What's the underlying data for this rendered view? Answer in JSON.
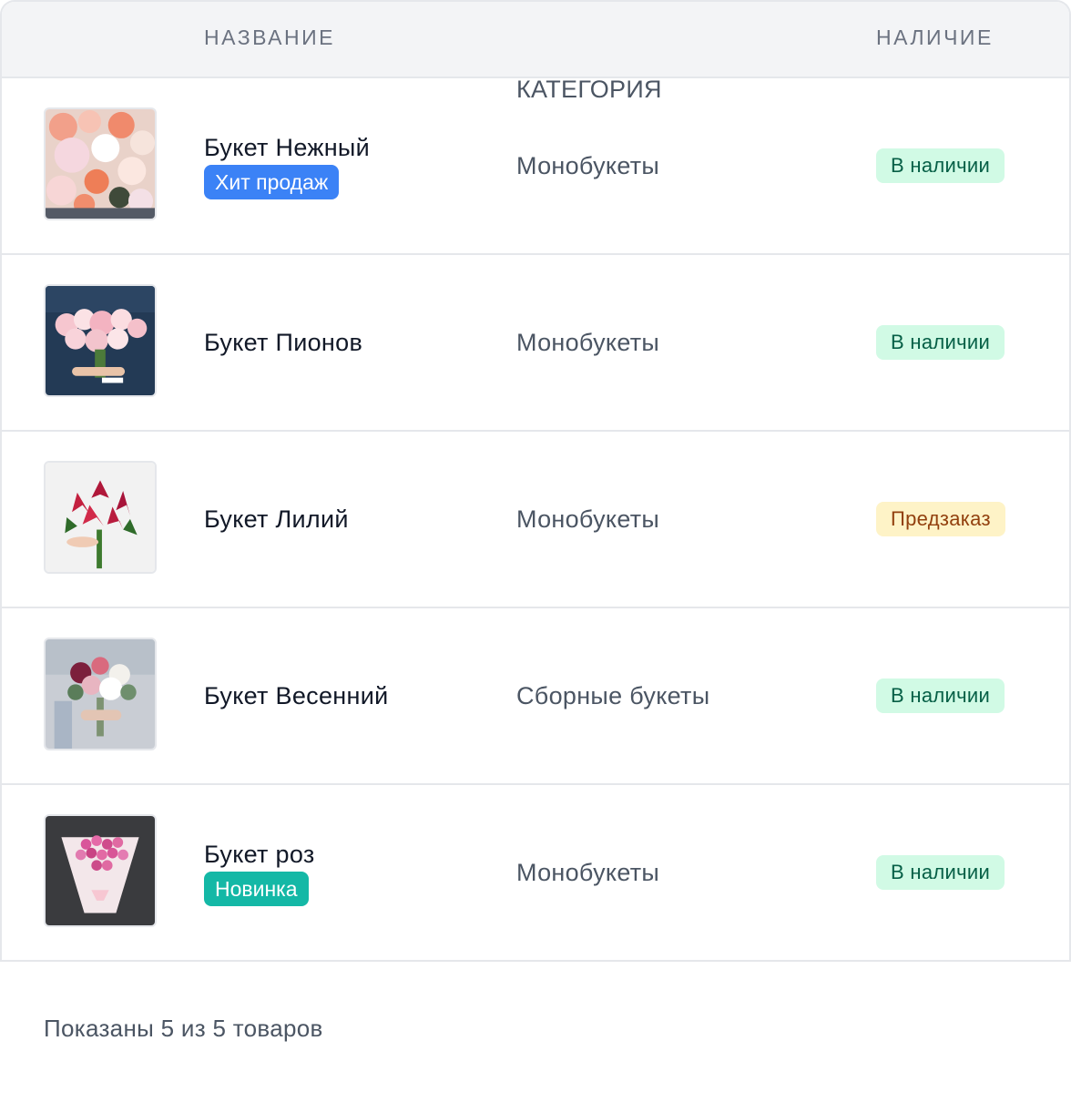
{
  "table": {
    "headers": {
      "name": "НАЗВАНИЕ",
      "category": "КАТЕГОРИЯ",
      "availability": "НАЛИЧИЕ"
    },
    "rows": [
      {
        "name": "Букет Нежный",
        "tag": "Хит продаж",
        "category": "Монобукеты",
        "availability": "В наличии",
        "thumb_icon": "peony-rose-bouquet-photo"
      },
      {
        "name": "Букет Пионов",
        "tag": "",
        "category": "Монобукеты",
        "availability": "В наличии",
        "thumb_icon": "peony-bouquet-photo"
      },
      {
        "name": "Букет Лилий",
        "tag": "",
        "category": "Монобукеты",
        "availability": "Предзаказ",
        "thumb_icon": "lily-bouquet-photo"
      },
      {
        "name": "Букет Весенний",
        "tag": "",
        "category": "Сборные букеты",
        "availability": "В наличии",
        "thumb_icon": "spring-bouquet-photo"
      },
      {
        "name": "Букет роз",
        "tag": "Новинка",
        "category": "Монобукеты",
        "availability": "В наличии",
        "thumb_icon": "rose-bouquet-photo"
      }
    ]
  },
  "footer": {
    "summary": "Показаны 5 из 5 товаров"
  },
  "colors": {
    "tag_hit": "#3b82f6",
    "tag_new": "#14b8a6",
    "badge_in_stock_bg": "#d1fae5",
    "badge_preorder_bg": "#fef3c7"
  }
}
